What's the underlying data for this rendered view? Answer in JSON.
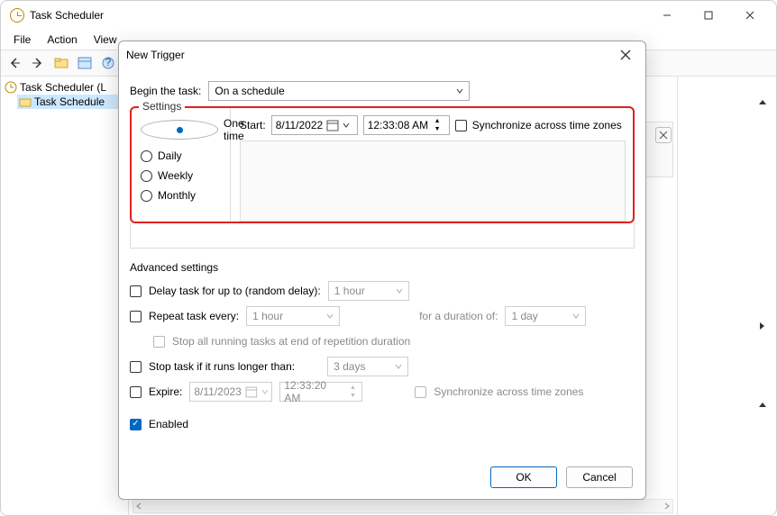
{
  "app": {
    "title": "Task Scheduler",
    "menus": {
      "file": "File",
      "action": "Action",
      "view": "View"
    },
    "tree": {
      "root": "Task Scheduler (L",
      "child": "Task Schedule"
    }
  },
  "dialog": {
    "title": "New Trigger",
    "begin_label": "Begin the task:",
    "begin_value": "On a schedule",
    "settings_label": "Settings",
    "radios": {
      "one_time": "One time",
      "daily": "Daily",
      "weekly": "Weekly",
      "monthly": "Monthly"
    },
    "start_label": "Start:",
    "start_date": "8/11/2022",
    "start_time": "12:33:08 AM",
    "sync_tz": "Synchronize across time zones",
    "advanced": {
      "title": "Advanced settings",
      "delay_label": "Delay task for up to (random delay):",
      "delay_value": "1 hour",
      "repeat_label": "Repeat task every:",
      "repeat_value": "1 hour",
      "duration_label": "for a duration of:",
      "duration_value": "1 day",
      "stop_all_label": "Stop all running tasks at end of repetition duration",
      "stop_if_label": "Stop task if it runs longer than:",
      "stop_if_value": "3 days",
      "expire_label": "Expire:",
      "expire_date": "8/11/2023",
      "expire_time": "12:33:20 AM",
      "expire_sync": "Synchronize across time zones",
      "enabled_label": "Enabled"
    },
    "buttons": {
      "ok": "OK",
      "cancel": "Cancel"
    }
  }
}
